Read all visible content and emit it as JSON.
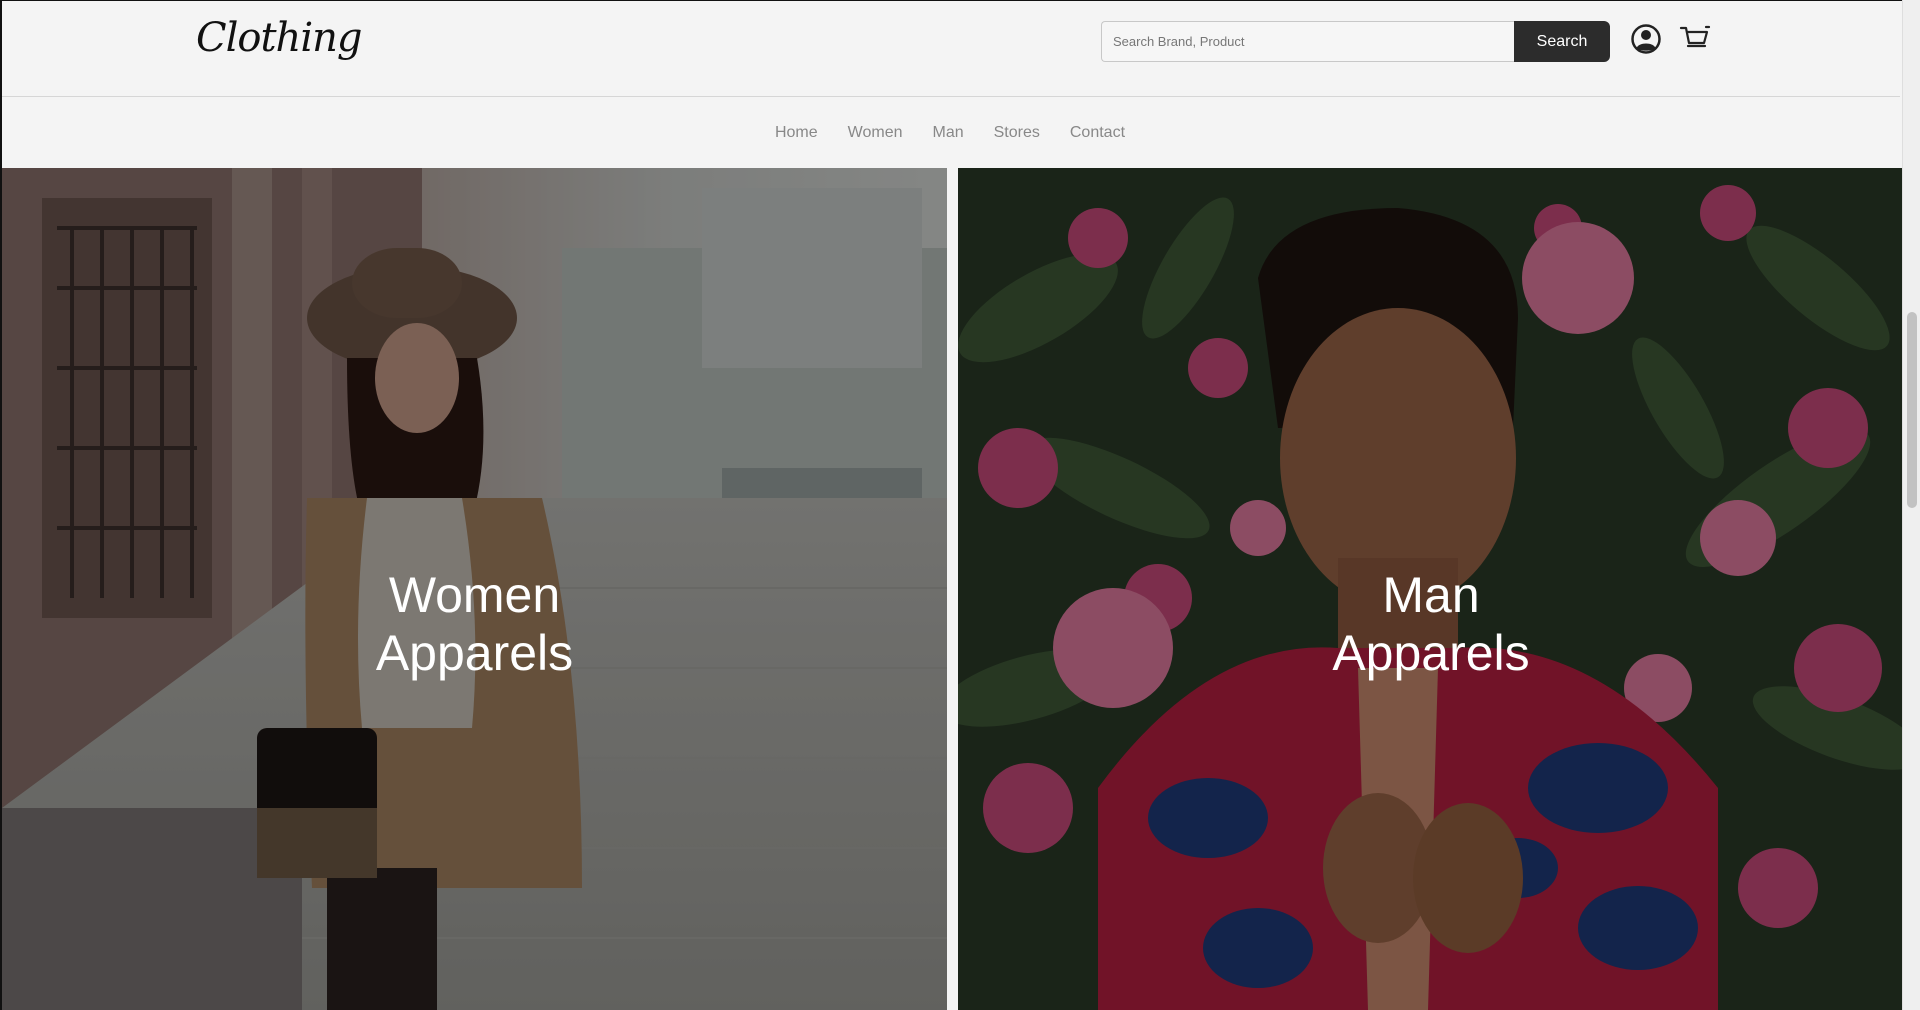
{
  "header": {
    "logo_text": "Clothing",
    "search": {
      "placeholder": "Search Brand, Product",
      "value": "",
      "button_label": "Search"
    },
    "icons": [
      "user-account-icon",
      "shopping-cart-icon"
    ]
  },
  "nav": {
    "items": [
      {
        "label": "Home"
      },
      {
        "label": "Women"
      },
      {
        "label": "Man"
      },
      {
        "label": "Stores"
      },
      {
        "label": "Contact"
      }
    ]
  },
  "hero": {
    "women": {
      "line1": "Women",
      "line2": "Apparels"
    },
    "man": {
      "line1": "Man",
      "line2": "Apparels"
    }
  },
  "colors": {
    "background": "#f4f4f4",
    "search_button": "#2c2c2c",
    "nav_text": "#888888",
    "overlay_text": "#ffffff"
  }
}
